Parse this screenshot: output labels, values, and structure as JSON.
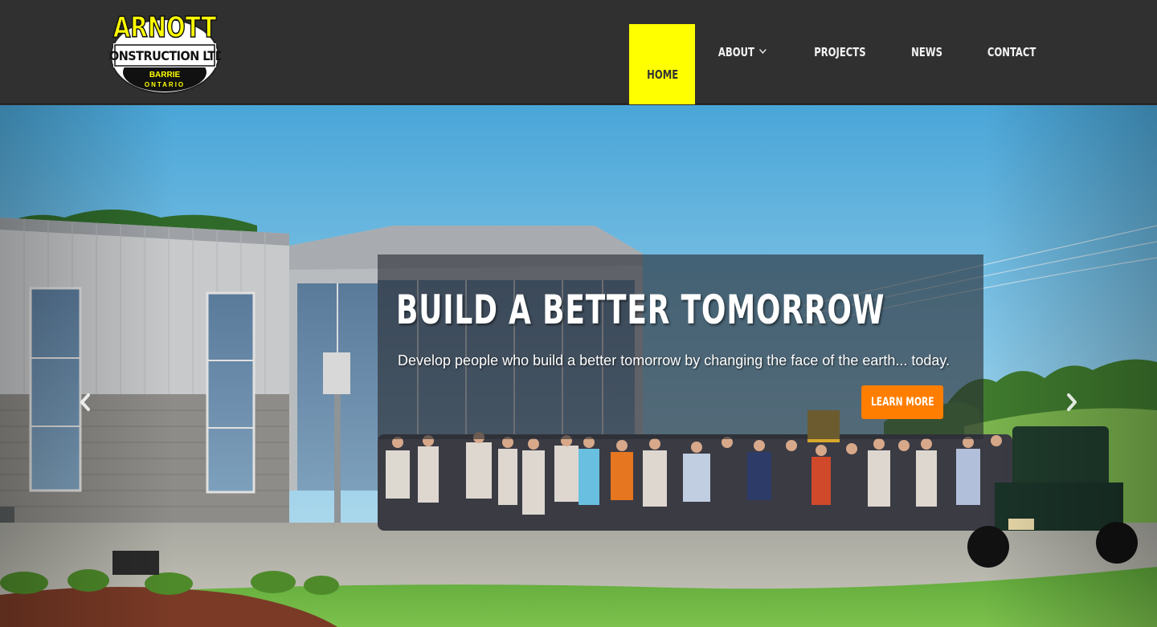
{
  "logo": {
    "name": "ARNOTT",
    "line2": "CONSTRUCTION LTD.",
    "city": "BARRIE",
    "province": "ONTARIO"
  },
  "nav": {
    "items": [
      {
        "label": "HOME",
        "active": true
      },
      {
        "label": "ABOUT",
        "has_dropdown": true
      },
      {
        "label": "PROJECTS"
      },
      {
        "label": "NEWS"
      },
      {
        "label": "CONTACT"
      }
    ]
  },
  "hero": {
    "title": "BUILD A BETTER TOMORROW",
    "subtitle": "Develop people who build a better tomorrow by changing the face of the earth... today.",
    "button_label": "LEARN MORE",
    "prev_icon": "chevron-left-icon",
    "next_icon": "chevron-right-icon"
  },
  "colors": {
    "header_bg": "#303030",
    "active_nav": "#ffff00",
    "button": "#ff7e00",
    "logo_yellow": "#ffff00"
  }
}
